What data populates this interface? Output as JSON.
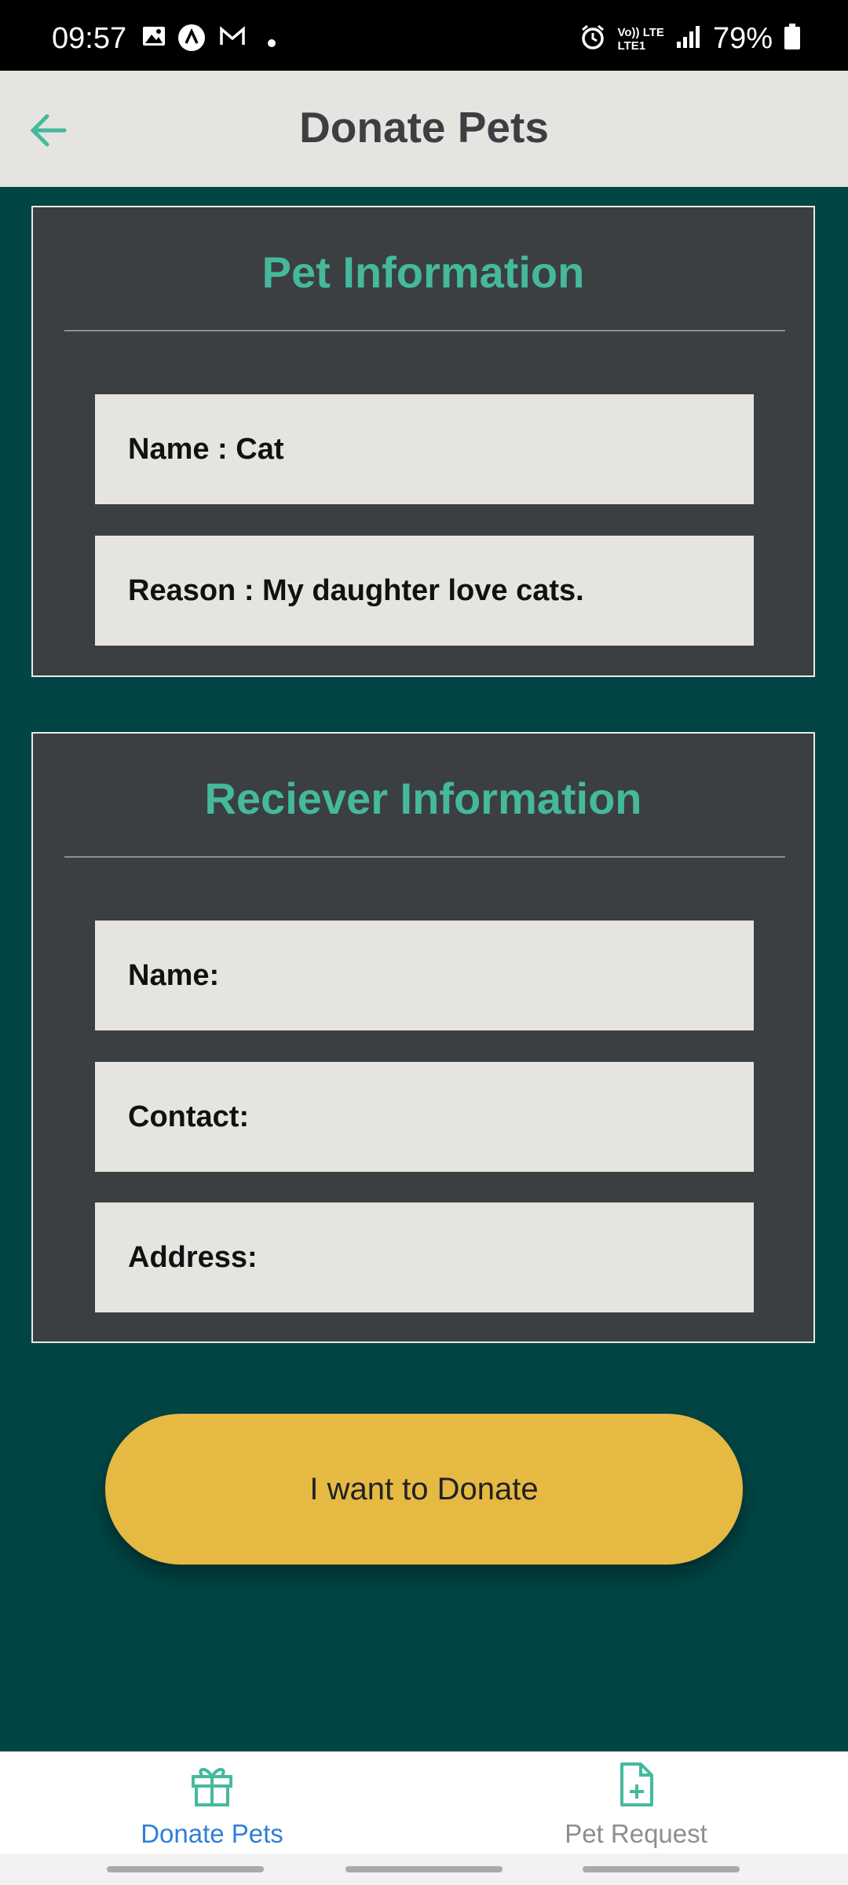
{
  "status_bar": {
    "time": "09:57",
    "battery": "79%",
    "network_top": "Vo)) LTE",
    "network_bottom": "LTE1"
  },
  "app_bar": {
    "title": "Donate Pets"
  },
  "pet_info": {
    "heading": "Pet Information",
    "name_field": "Name : Cat",
    "reason_field": "Reason : My daughter love cats."
  },
  "receiver_info": {
    "heading": "Reciever Information",
    "name_field": "Name:",
    "contact_field": "Contact:",
    "address_field": "Address:"
  },
  "donate_button": {
    "label": "I want to Donate"
  },
  "bottom_nav": {
    "items": [
      {
        "label": "Donate Pets",
        "icon": "gift-icon",
        "active": true
      },
      {
        "label": "Pet Request",
        "icon": "file-add-icon",
        "active": false
      }
    ]
  },
  "colors": {
    "accent": "#45b99c",
    "background": "#014544",
    "card": "#3b3f42",
    "button": "#e6b943",
    "nav_active": "#2f7fd6",
    "nav_inactive": "#8e8e8e"
  }
}
